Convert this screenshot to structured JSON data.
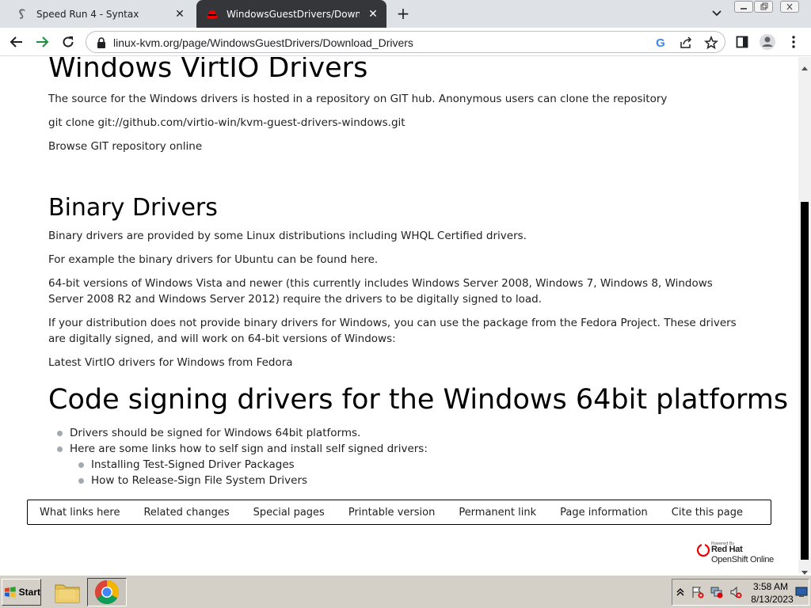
{
  "browser": {
    "tabs": [
      {
        "title": "Speed Run 4 - Syntax",
        "favicon": "syntax-s-icon",
        "active": false
      },
      {
        "title": "WindowsGuestDrivers/Download Dr",
        "favicon": "redhat-icon",
        "active": true
      }
    ],
    "new_tab_label": "+",
    "close_glyph": "✕",
    "url": "linux-kvm.org/page/WindowsGuestDrivers/Download_Drivers"
  },
  "page": {
    "sections": [
      {
        "heading": "Windows VirtIO Drivers",
        "paragraphs": [
          "The source for the Windows drivers is hosted in a repository on GIT hub. Anonymous users can clone the repository",
          "git clone git://github.com/virtio-win/kvm-guest-drivers-windows.git",
          "Browse GIT repository online"
        ]
      },
      {
        "heading": "Binary Drivers",
        "paragraphs": [
          "Binary drivers are provided by some Linux distributions including WHQL Certified drivers.",
          "For example the binary drivers for Ubuntu can be found here.",
          "64-bit versions of Windows Vista and newer (this currently includes Windows Server 2008, Windows 7, Windows 8, Windows Server 2008 R2 and Windows Server 2012) require the drivers to be digitally signed to load.",
          "If your distribution does not provide binary drivers for Windows, you can use the package from the Fedora Project. These drivers are digitally signed, and will work on 64-bit versions of Windows:",
          "Latest VirtIO drivers for Windows from Fedora"
        ]
      },
      {
        "heading": "Code signing drivers for the Windows 64bit platforms",
        "bullets": [
          "Drivers should be signed for Windows 64bit platforms.",
          "Here are some links how to self sign and install self signed drivers:"
        ],
        "sub_bullets": [
          "Installing Test-Signed Driver Packages",
          "How to Release-Sign File System Drivers"
        ]
      }
    ],
    "footer_links": [
      "What links here",
      "Related changes",
      "Special pages",
      "Printable version",
      "Permanent link",
      "Page information",
      "Cite this page"
    ],
    "powered_by": {
      "small": "Powered By",
      "name": "Red Hat",
      "product": "OpenShift Online"
    }
  },
  "taskbar": {
    "start_label": "Start",
    "apps": [
      "file-explorer-icon",
      "chrome-icon"
    ],
    "clock_time": "3:58 AM",
    "clock_date": "8/13/2023"
  },
  "colors": {
    "tabbar_bg": "#dee1e6",
    "active_tab_bg": "#35363a",
    "taskbar_bg": "#d4d0c8",
    "text": "#202122",
    "scroll_thumb": "#000000"
  }
}
